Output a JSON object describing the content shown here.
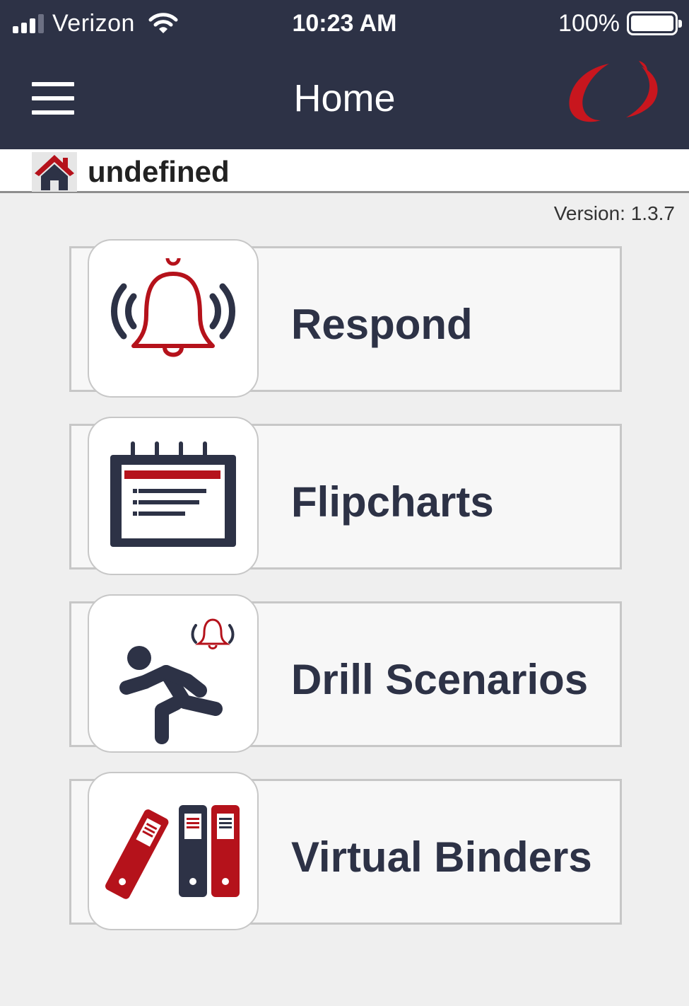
{
  "status_bar": {
    "carrier": "Verizon",
    "time": "10:23 AM",
    "battery": "100%"
  },
  "nav": {
    "title": "Home"
  },
  "breadcrumb": {
    "label": "undefined"
  },
  "version": "Version: 1.3.7",
  "menu": {
    "items": [
      {
        "label": "Respond",
        "icon": "alarm-bell-icon"
      },
      {
        "label": "Flipcharts",
        "icon": "flipchart-icon"
      },
      {
        "label": "Drill Scenarios",
        "icon": "running-person-icon"
      },
      {
        "label": "Virtual Binders",
        "icon": "binders-icon"
      }
    ]
  },
  "colors": {
    "header_bg": "#2d3246",
    "accent_red": "#b5121b",
    "text_dark": "#2d3246",
    "page_bg": "#efefef"
  }
}
